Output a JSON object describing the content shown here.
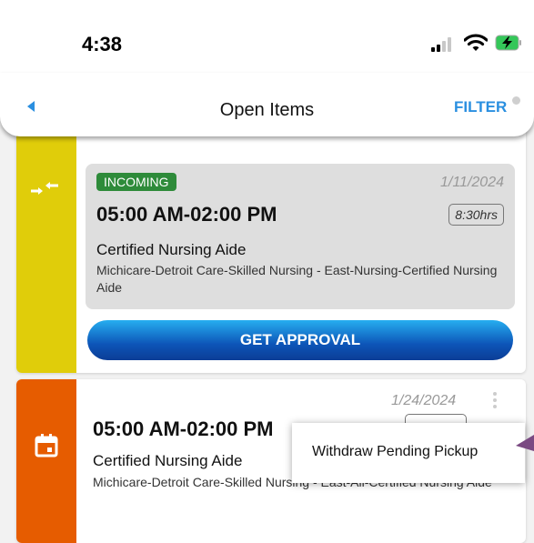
{
  "status_bar": {
    "time": "4:38"
  },
  "nav": {
    "back_icon": "back-arrow-icon",
    "title": "Open Items",
    "filter_label": "FILTER"
  },
  "cards": [
    {
      "icon": "swap-arrows-icon",
      "stripe_color": "#e0cd0a",
      "badge": "INCOMING",
      "badge_color": "#2e8b3a",
      "date": "1/11/2024",
      "shift_time": "05:00 AM-02:00 PM",
      "hours": "8:30hrs",
      "role": "Certified Nursing Aide",
      "department": "Michicare-Detroit Care-Skilled Nursing - East-Nursing-Certified Nursing Aide",
      "action_label": "GET APPROVAL"
    },
    {
      "icon": "calendar-icon",
      "stripe_color": "#e65c00",
      "date": "1/24/2024",
      "shift_time": "05:00 AM-02:00 PM",
      "role": "Certified Nursing Aide",
      "department": "Michicare-Detroit Care-Skilled Nursing - East-All-Certified Nursing Aide"
    }
  ],
  "context_menu": {
    "item": "Withdraw Pending Pickup"
  }
}
